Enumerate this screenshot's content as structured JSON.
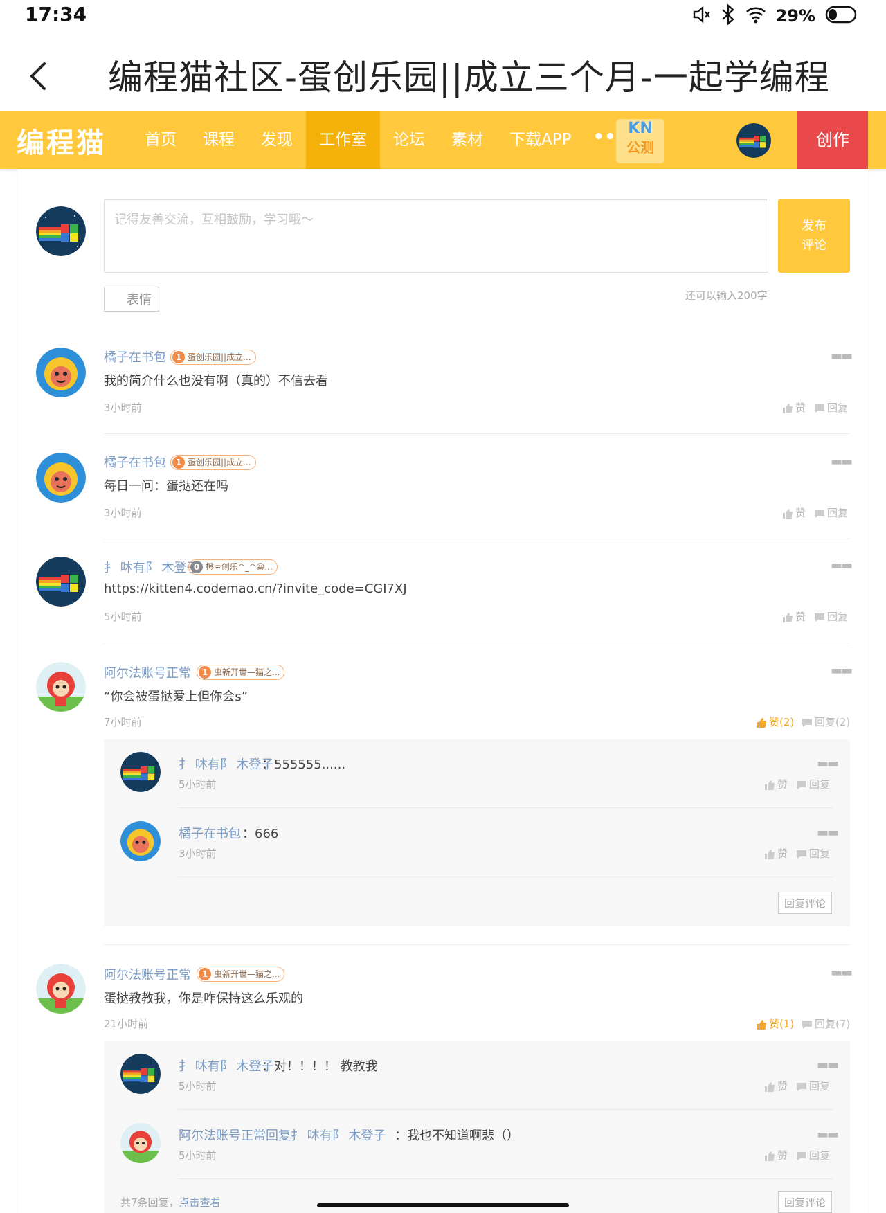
{
  "status": {
    "time": "17:34",
    "battery": "29%"
  },
  "appbar": {
    "title": "编程猫社区-蛋创乐园||成立三个月-一起学编程"
  },
  "nav": {
    "logo": "编程猫",
    "links": [
      "首页",
      "课程",
      "发现",
      "工作室",
      "论坛",
      "素材",
      "下载APP"
    ],
    "more": "•••",
    "kn_top": "KN",
    "kn_bottom": "公测",
    "create": "创作"
  },
  "composer": {
    "placeholder": "记得友善交流，互相鼓励，学习哦～",
    "publish_line1": "发布",
    "publish_line2": "评论",
    "emoji": "表情",
    "remaining": "还可以输入200字"
  },
  "comments": [
    {
      "name": "橘子在书包",
      "level": "1",
      "badge": "蛋创乐园||成立...",
      "text": "我的简介什么也没有啊（真的）不信去看",
      "time": "3小时前",
      "like": "赞",
      "reply": "回复"
    },
    {
      "name": "橘子在书包",
      "level": "1",
      "badge": "蛋创乐园||成立...",
      "text": "每日一问：蛋挞还在吗",
      "time": "3小时前",
      "like": "赞",
      "reply": "回复"
    },
    {
      "name": "扌 㕲有阝 木登子",
      "level": "0",
      "badge": "橙♒创乐^_^😀...",
      "text": "https://kitten4.codemao.cn/?invite_code=CGI7XJ",
      "time": "5小时前",
      "like": "赞",
      "reply": "回复"
    },
    {
      "name": "阿尔法账号正常",
      "level": "1",
      "badge": "虫新开世—猫之...",
      "text": "“你会被蛋挞爱上但你会s”",
      "time": "7小时前",
      "like": "赞(2)",
      "reply": "回复(2)",
      "replies": [
        {
          "name": "扌 㕲有阝 木登子",
          "text": "：555555......",
          "time": "5小时前",
          "like": "赞",
          "reply": "回复"
        },
        {
          "name": "橘子在书包",
          "text": "：666",
          "time": "3小时前",
          "like": "赞",
          "reply": "回复"
        }
      ],
      "reply_button": "回复评论"
    },
    {
      "name": "阿尔法账号正常",
      "level": "1",
      "badge": "虫新开世—猫之...",
      "text": "蛋挞教教我，你是咋保持这么乐观的",
      "time": "21小时前",
      "like": "赞(1)",
      "reply": "回复(7)",
      "replies": [
        {
          "name": "扌 㕲有阝 木登子",
          "text": "：对！！！！ 教教我",
          "time": "5小时前",
          "like": "赞",
          "reply": "回复"
        },
        {
          "name": "阿尔法账号正常回复扌 㕲有阝 木登子",
          "text": "：我也不知道啊悲（）",
          "time": "5小时前",
          "like": "赞",
          "reply": "回复"
        }
      ],
      "total_prefix": "共7条回复，",
      "total_link": "点击查看",
      "reply_button": "回复评论"
    }
  ],
  "colors": {
    "nav": "#ffc83d",
    "nav_active": "#f4b10a",
    "create": "#e9494b",
    "name": "#7a9cc6",
    "like_on": "#f5a623"
  },
  "icons": [
    "back-icon",
    "mute-icon",
    "bluetooth-icon",
    "wifi-icon",
    "battery-icon",
    "thumb-up-icon",
    "reply-icon",
    "more-icon"
  ]
}
